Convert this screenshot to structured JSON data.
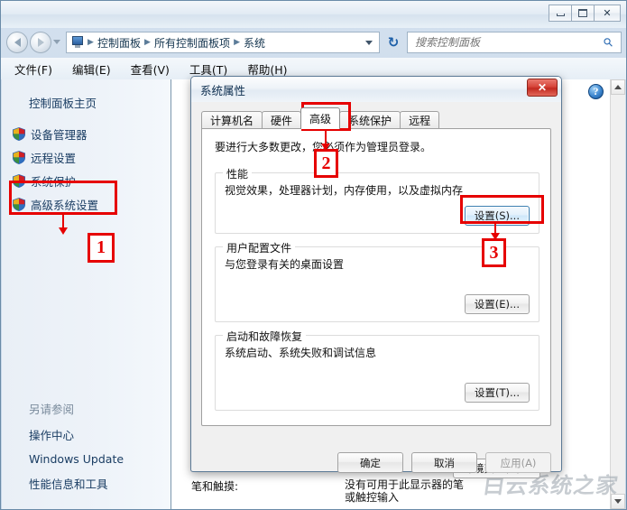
{
  "window": {
    "minimize_label": "最小化",
    "maximize_label": "最大化",
    "close_label": "✕"
  },
  "nav": {
    "back_label": "后退",
    "forward_label": "前进",
    "history_label": "历史记录",
    "refresh_label": "↻",
    "breadcrumb": [
      "控制面板",
      "所有控制面板项",
      "系统"
    ],
    "separator": "▶"
  },
  "search": {
    "placeholder": "搜索控制面板",
    "value": "",
    "icon": "search-icon"
  },
  "menubar": {
    "items": [
      "文件(F)",
      "编辑(E)",
      "查看(V)",
      "工具(T)",
      "帮助(H)"
    ]
  },
  "sidebar": {
    "home_label": "控制面板主页",
    "items": [
      {
        "label": "设备管理器",
        "icon": "shield-icon"
      },
      {
        "label": "远程设置",
        "icon": "shield-icon"
      },
      {
        "label": "系统保护",
        "icon": "shield-icon"
      },
      {
        "label": "高级系统设置",
        "icon": "shield-icon"
      }
    ],
    "seealso_title": "另请参阅",
    "seealso_items": [
      "操作中心",
      "Windows Update",
      "性能信息和工具"
    ]
  },
  "main": {
    "help_label": "?",
    "pen_touch_label": "笔和触摸:",
    "pen_touch_value_line1": "没有可用于此显示器的笔",
    "pen_touch_value_line2": "或触控输入"
  },
  "dialog": {
    "title": "系统属性",
    "close_label": "✕",
    "tabs": [
      {
        "label": "计算机名",
        "active": false
      },
      {
        "label": "硬件",
        "active": false
      },
      {
        "label": "高级",
        "active": true
      },
      {
        "label": "系统保护",
        "active": false
      },
      {
        "label": "远程",
        "active": false
      }
    ],
    "admin_note": "要进行大多数更改，您必须作为管理员登录。",
    "groups": [
      {
        "title": "性能",
        "description": "视觉效果，处理器计划，内存使用，以及虚拟内存",
        "button": "设置(S)..."
      },
      {
        "title": "用户配置文件",
        "description": "与您登录有关的桌面设置",
        "button": "设置(E)..."
      },
      {
        "title": "启动和故障恢复",
        "description": "系统启动、系统失败和调试信息",
        "button": "设置(T)..."
      }
    ],
    "env_button": "环境变量(N)...",
    "footer": {
      "ok": "确定",
      "cancel": "取消",
      "apply": "应用(A)"
    }
  },
  "annotations": [
    {
      "number": "1",
      "target": "高级系统设置"
    },
    {
      "number": "2",
      "target": "高级 选项卡"
    },
    {
      "number": "3",
      "target": "性能 设置按钮"
    }
  ],
  "watermark": {
    "text": "白云系统之家"
  },
  "colors": {
    "annotation_red": "#e60000",
    "close_red": "#c12a20",
    "link_blue": "#1a3d63",
    "focus_blue": "#3c7fb1"
  }
}
